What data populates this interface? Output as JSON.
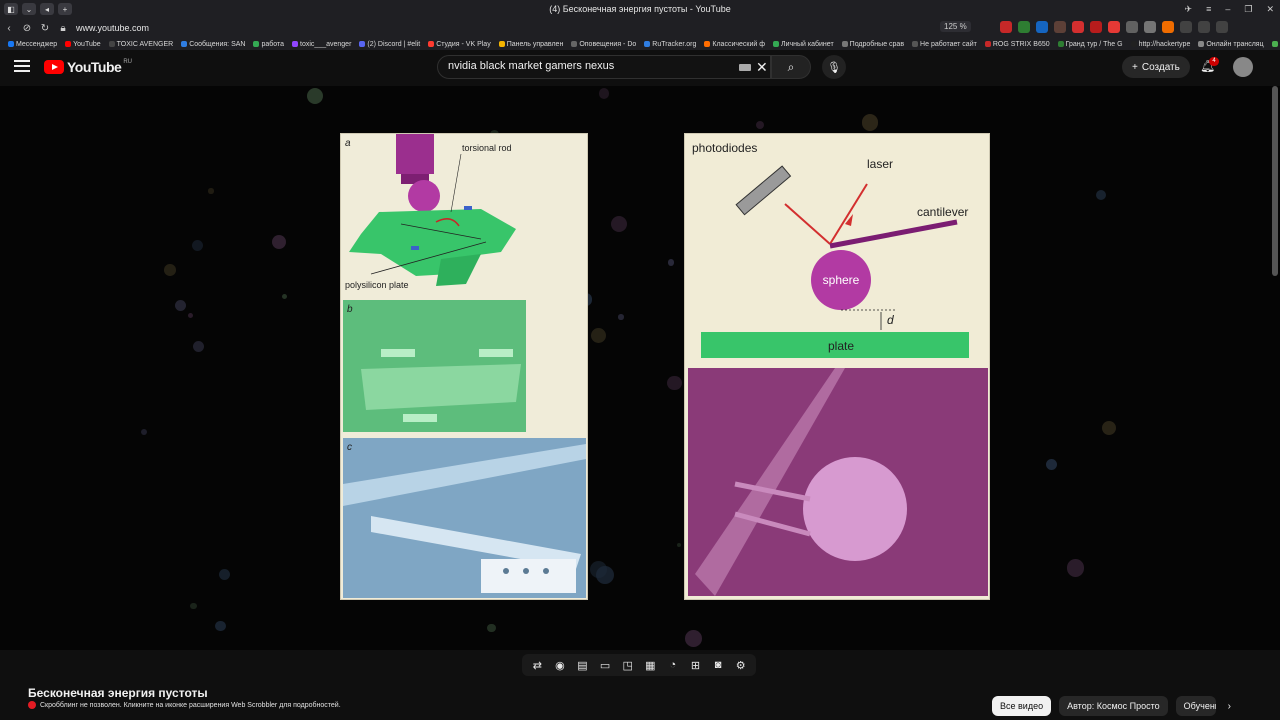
{
  "browser": {
    "window_title": "(4) Бесконечная энергия пустоты - YouTube",
    "url": "www.youtube.com",
    "zoom": "125 %",
    "bookmarks": [
      {
        "label": "Мессенджер",
        "color": "#1877f2"
      },
      {
        "label": "YouTube",
        "color": "#ff0000"
      },
      {
        "label": "TOXIC AVENGER",
        "color": "#444444"
      },
      {
        "label": "Сообщения: SAN",
        "color": "#2f7de1"
      },
      {
        "label": "работа",
        "color": "#34a853"
      },
      {
        "label": "toxic___avenger",
        "color": "#9146ff"
      },
      {
        "label": "(2) Discord | #elit",
        "color": "#5865f2"
      },
      {
        "label": "Студия - VK Play",
        "color": "#ff3b30"
      },
      {
        "label": "Панель управлен",
        "color": "#f4b400"
      },
      {
        "label": "Оповещения - Do",
        "color": "#666666"
      },
      {
        "label": "RuTracker.org",
        "color": "#2f7de1"
      },
      {
        "label": "Классический ф",
        "color": "#ff6d00"
      },
      {
        "label": "Личный кабинет",
        "color": "#34a853"
      },
      {
        "label": "Подробные срав",
        "color": "#777777"
      },
      {
        "label": "Не работает сайт",
        "color": "#555555"
      },
      {
        "label": "ROG STRIX B650",
        "color": "#c62828"
      },
      {
        "label": "Гранд тур / The G",
        "color": "#2e7d32"
      },
      {
        "label": "http://hackertype",
        "color": "#212121"
      },
      {
        "label": "Онлайн трансляц",
        "color": "#888888"
      },
      {
        "label": "Ов",
        "color": "#4caf50"
      }
    ]
  },
  "header": {
    "logo_text": "YouTube",
    "region": "RU",
    "search_value": "nvidia black market gamers nexus",
    "create_label": "Создать",
    "notification_count": "4"
  },
  "figure_left": {
    "label_a": "a",
    "label_b": "b",
    "label_c": "c",
    "torsional_rod": "torsional rod",
    "polysilicon_plate": "polysilicon plate"
  },
  "figure_right": {
    "photodiodes": "photodiodes",
    "laser": "laser",
    "cantilever": "cantilever",
    "sphere": "sphere",
    "d": "d",
    "plate": "plate"
  },
  "video": {
    "title": "Бесконечная энергия пустоты",
    "scrobble_message": "Скробблинг не позволен. Кликните на иконке расширения Web Scrobbler для подробностей."
  },
  "chips": {
    "all": "Все видео",
    "author": "Автор: Космос Просто",
    "learn": "Обучение"
  }
}
